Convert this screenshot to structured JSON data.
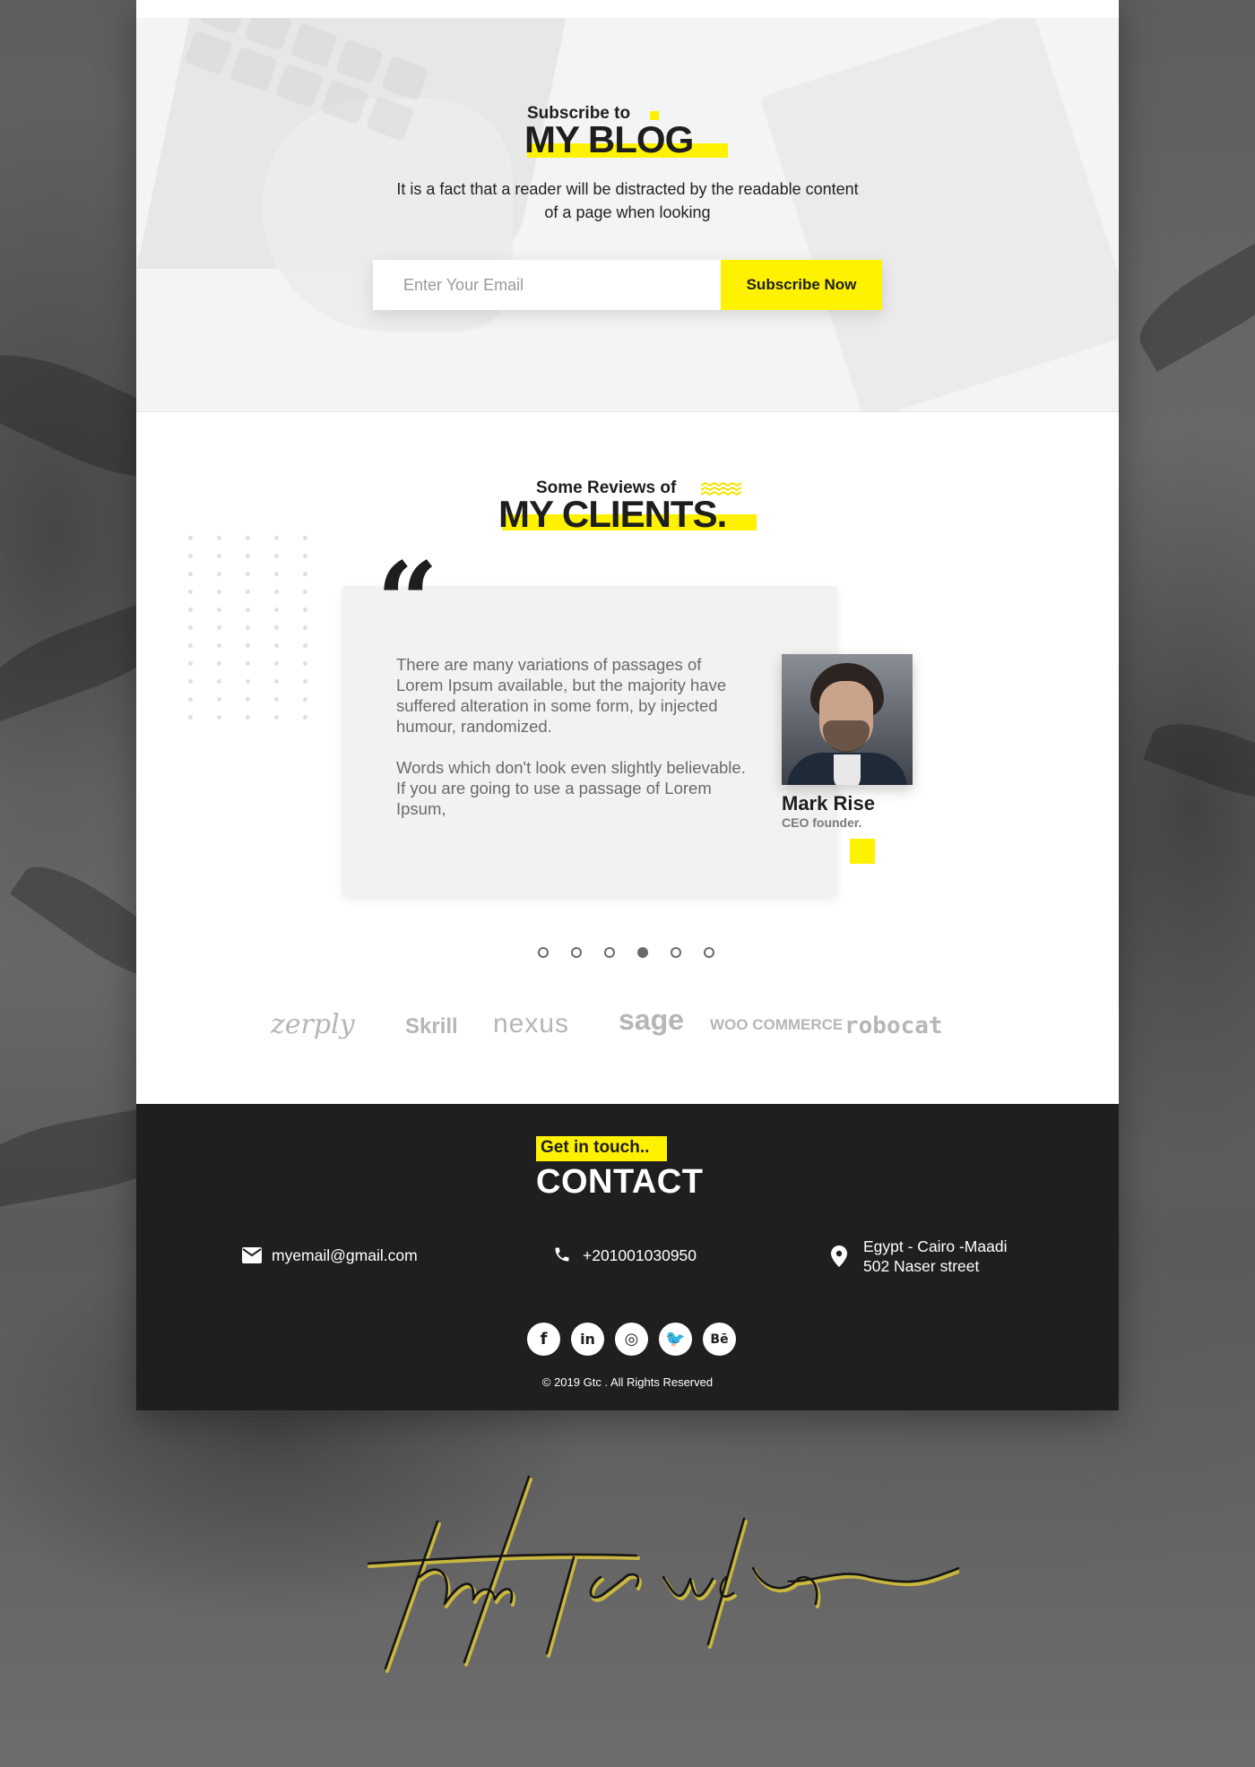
{
  "subscribe": {
    "eyebrow": "Subscribe to",
    "title": "MY BLOG",
    "description": "It is a fact that a reader will be distracted by the readable content of a page when looking",
    "email_placeholder": "Enter Your Email",
    "button_label": "Subscribe Now"
  },
  "reviews": {
    "eyebrow": "Some Reviews of",
    "title": "MY CLIENTS.",
    "quote_mark": "“",
    "paragraphs": [
      "There are many variations of passages of Lorem Ipsum available, but the majority have suffered alteration in some form, by injected humour, randomized.",
      "Words which don't look even slightly believable. If you are going to use a passage of Lorem Ipsum,"
    ],
    "client": {
      "name": "Mark Rise",
      "role": "CEO founder."
    },
    "pagination": {
      "total": 6,
      "active_index": 3
    }
  },
  "brands": [
    "zerply",
    "Skrill",
    "nexus",
    "sage",
    "WOO COMMERCE",
    "robocat"
  ],
  "contact": {
    "eyebrow": "Get in touch..",
    "title": "CONTACT",
    "email": "myemail@gmail.com",
    "phone": "+201001030950",
    "address_line1": "Egypt - Cairo -Maadi",
    "address_line2": "502 Naser street",
    "socials": [
      "facebook-icon",
      "linkedin-icon",
      "instagram-icon",
      "twitter-icon",
      "behance-icon"
    ],
    "social_glyphs": [
      "f",
      "in",
      "◎",
      "🐦",
      "Bē"
    ],
    "copyright": "© 2019 Gtc . All Rights Reserved"
  },
  "signature": "thanks for watching",
  "colors": {
    "accent": "#fff200",
    "dark": "#1f1f1f",
    "text_gray": "#6a6a6a",
    "signature": "#d4c03a"
  }
}
